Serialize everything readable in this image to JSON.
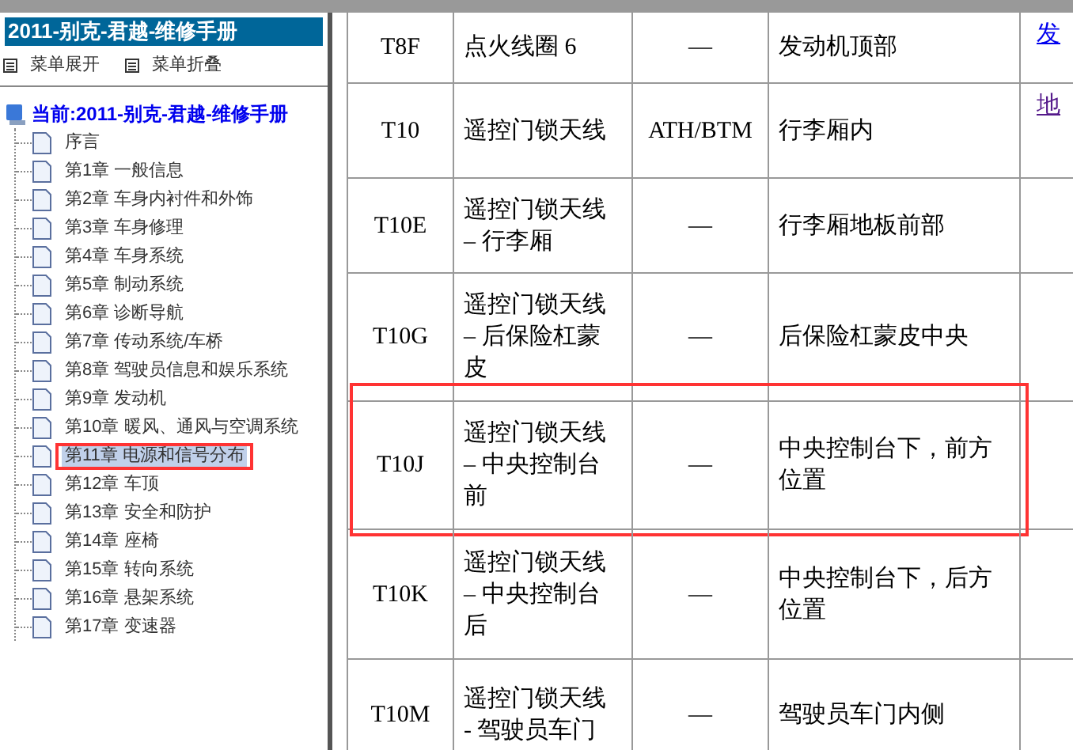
{
  "sidebar": {
    "title": "2011-别克-君越-维修手册",
    "menu_buttons": [
      "菜单展开",
      "菜单折叠"
    ],
    "tree": {
      "label": "当前:2011-别克-君越-维修手册",
      "children": [
        {
          "label": "序言",
          "selected": false,
          "annotated": false
        },
        {
          "label": "第1章 一般信息",
          "selected": false,
          "annotated": false
        },
        {
          "label": "第2章 车身内衬件和外饰",
          "selected": false,
          "annotated": false
        },
        {
          "label": "第3章 车身修理",
          "selected": false,
          "annotated": false
        },
        {
          "label": "第4章 车身系统",
          "selected": false,
          "annotated": false
        },
        {
          "label": "第5章 制动系统",
          "selected": false,
          "annotated": false
        },
        {
          "label": "第6章 诊断导航",
          "selected": false,
          "annotated": false
        },
        {
          "label": "第7章 传动系统/车桥",
          "selected": false,
          "annotated": false
        },
        {
          "label": "第8章 驾驶员信息和娱乐系统",
          "selected": false,
          "annotated": false
        },
        {
          "label": "第9章 发动机",
          "selected": false,
          "annotated": false
        },
        {
          "label": "第10章 暖风、通风与空调系统",
          "selected": false,
          "annotated": false
        },
        {
          "label": "第11章 电源和信号分布",
          "selected": true,
          "annotated": true
        },
        {
          "label": "第12章 车顶",
          "selected": false,
          "annotated": false
        },
        {
          "label": "第13章 安全和防护",
          "selected": false,
          "annotated": false
        },
        {
          "label": "第14章 座椅",
          "selected": false,
          "annotated": false
        },
        {
          "label": "第15章 转向系统",
          "selected": false,
          "annotated": false
        },
        {
          "label": "第16章 悬架系统",
          "selected": false,
          "annotated": false
        },
        {
          "label": "第17章 变速器",
          "selected": false,
          "annotated": false
        }
      ]
    }
  },
  "table": {
    "rows": [
      {
        "connector": "T8F",
        "description": "点火线圈 6",
        "option": "—",
        "location": "发动机顶部",
        "link": {
          "text": "发",
          "visited": false
        },
        "annotated": false
      },
      {
        "connector": "T10",
        "description": "遥控门锁天线",
        "option": "ATH/BTM",
        "location": "行李厢内",
        "link": {
          "text": "地",
          "visited": true
        },
        "annotated": false
      },
      {
        "connector": "T10E",
        "description": "遥控门锁天线 – 行李厢",
        "option": "—",
        "location": "行李厢地板前部",
        "annotated": false
      },
      {
        "connector": "T10G",
        "description": "遥控门锁天线 – 后保险杠蒙皮",
        "option": "—",
        "location": "后保险杠蒙皮中央",
        "annotated": false
      },
      {
        "connector": "T10J",
        "description": "遥控门锁天线 – 中央控制台前",
        "option": "—",
        "location": "中央控制台下，前方位置",
        "annotated": true
      },
      {
        "connector": "T10K",
        "description": "遥控门锁天线 – 中央控制台后",
        "option": "—",
        "location": "中央控制台下，后方位置",
        "annotated": false
      },
      {
        "connector": "T10M",
        "description": "遥控门锁天线 - 驾驶员车门",
        "option": "—",
        "location": "驾驶员车门内侧",
        "annotated": false
      }
    ]
  }
}
